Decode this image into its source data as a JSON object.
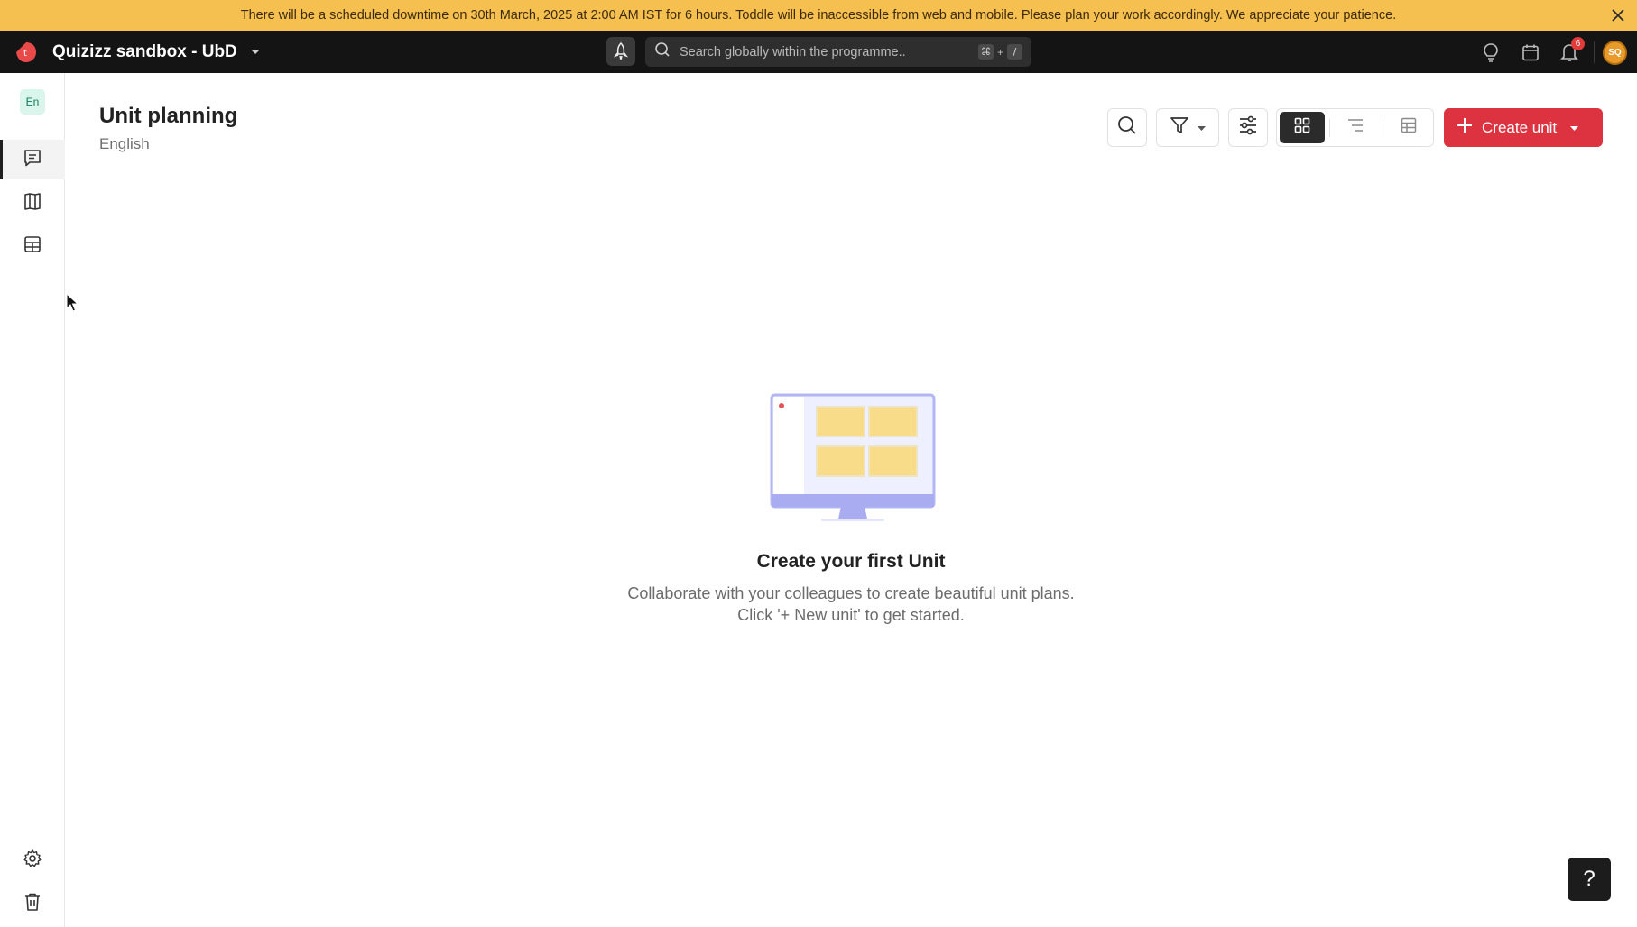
{
  "banner": {
    "message": "There will be a scheduled downtime on 30th March, 2025 at 2:00 AM IST for 6 hours. Toddle will be inaccessible from web and mobile. Please plan your work accordingly. We appreciate your patience.",
    "close_icon": "close-icon"
  },
  "header": {
    "workspace_name": "Quizizz sandbox - UbD",
    "search_placeholder": "Search globally within the programme..",
    "shortcut_keys": [
      "⌘",
      "+",
      "/"
    ],
    "notification_count": "6",
    "avatar_initials": "SQ",
    "icons": [
      "brand-logo-icon",
      "rocket-icon",
      "search-icon",
      "lightbulb-icon",
      "calendar-icon",
      "bell-icon"
    ]
  },
  "sidebar": {
    "language_chip": "En",
    "items": [
      {
        "icon": "chat-icon",
        "active": true
      },
      {
        "icon": "book-icon",
        "active": false
      },
      {
        "icon": "grid-table-icon",
        "active": false
      }
    ],
    "bottom": [
      {
        "icon": "gear-icon"
      },
      {
        "icon": "trash-icon"
      }
    ]
  },
  "page": {
    "title": "Unit planning",
    "subtitle": "English"
  },
  "toolbar": {
    "create_label": "Create unit",
    "views": [
      "grid-view-icon",
      "list-view-icon",
      "table-view-icon"
    ],
    "active_view": "grid-view-icon"
  },
  "empty_state": {
    "title": "Create your first Unit",
    "line1": "Collaborate with your colleagues to create beautiful unit plans.",
    "line2": "Click '+ New unit' to get started."
  },
  "help": {
    "label": "?"
  },
  "colors": {
    "banner": "#f5c04f",
    "header": "#141414",
    "primary": "#dd3341",
    "lang_chip": "#d9f5ec",
    "avatar": "#e89b2b"
  }
}
